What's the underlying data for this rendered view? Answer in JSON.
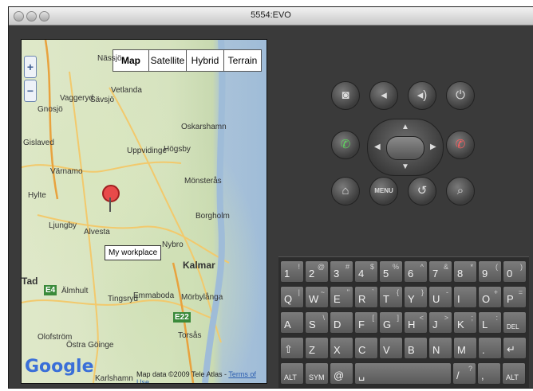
{
  "window": {
    "title": "5554:EVO"
  },
  "map": {
    "types": [
      "Map",
      "Satellite",
      "Hybrid",
      "Terrain"
    ],
    "selected_type": "Map",
    "zoom_in": "+",
    "zoom_out": "−",
    "marker_label": "My workplace",
    "places": [
      "Nässjö",
      "Vaggeryd",
      "Sävsjö",
      "Vetlanda",
      "Gnosjö",
      "Gislaved",
      "Värnamo",
      "Uppvidinge",
      "Högsby",
      "Oskarshamn",
      "Hyltе",
      "Ljungby",
      "Alvesta",
      "Mönsterås",
      "Borgholm",
      "Nybro",
      "Kalmar",
      "Älmhult",
      "Tingsryd",
      "Emmaboda",
      "Mörbylånga",
      "Torsås",
      "Olofström",
      "Östra Göinge",
      "Karlshamn",
      "Tad"
    ],
    "road_labels": [
      "E4",
      "E22"
    ],
    "logo": "Google",
    "copyright_text": "Map data ©2009 Tele Atlas - ",
    "terms_link": "Terms of Use"
  },
  "controls": {
    "camera": "camera-icon",
    "vol_down": "volume-down-icon",
    "vol_up": "volume-up-icon",
    "power": "power-icon",
    "call": "call-icon",
    "end_call": "end-call-icon",
    "home": "home-icon",
    "menu_label": "MENU",
    "back": "back-icon",
    "search": "search-icon"
  },
  "keyboard": {
    "row1": [
      [
        "1",
        "!"
      ],
      [
        "2",
        "@"
      ],
      [
        "3",
        "#"
      ],
      [
        "4",
        "$"
      ],
      [
        "5",
        "%"
      ],
      [
        "6",
        "^"
      ],
      [
        "7",
        "&"
      ],
      [
        "8",
        "*"
      ],
      [
        "9",
        "("
      ],
      [
        "0",
        ")"
      ]
    ],
    "row2": [
      [
        "Q",
        "|"
      ],
      [
        "W",
        "~"
      ],
      [
        "E",
        "\""
      ],
      [
        "R",
        "`"
      ],
      [
        "T",
        "{"
      ],
      [
        "Y",
        "}"
      ],
      [
        "U",
        "-"
      ],
      [
        "I",
        ""
      ],
      [
        "O",
        "+"
      ],
      [
        "P",
        "="
      ]
    ],
    "row3": [
      [
        "A",
        ""
      ],
      [
        "S",
        "\\"
      ],
      [
        "D",
        ""
      ],
      [
        "F",
        "["
      ],
      [
        "G",
        "]"
      ],
      [
        "H",
        "<"
      ],
      [
        "J",
        ">"
      ],
      [
        "K",
        ";"
      ],
      [
        "L",
        ":"
      ],
      [
        "DEL",
        ""
      ]
    ],
    "row4": [
      [
        "⇧",
        ""
      ],
      [
        "Z",
        ""
      ],
      [
        "X",
        ""
      ],
      [
        "C",
        ""
      ],
      [
        "V",
        ""
      ],
      [
        "B",
        ""
      ],
      [
        "N",
        ""
      ],
      [
        "M",
        ""
      ],
      [
        ".",
        ""
      ],
      [
        "↵",
        ""
      ]
    ],
    "row5_alt": "ALT",
    "row5_sym": "SYM",
    "row5_at": "@",
    "row5_space": "␣",
    "row5_slash": "/",
    "row5_slash_sub": "?",
    "row5_comma": ",",
    "row5_alt2": "ALT"
  }
}
